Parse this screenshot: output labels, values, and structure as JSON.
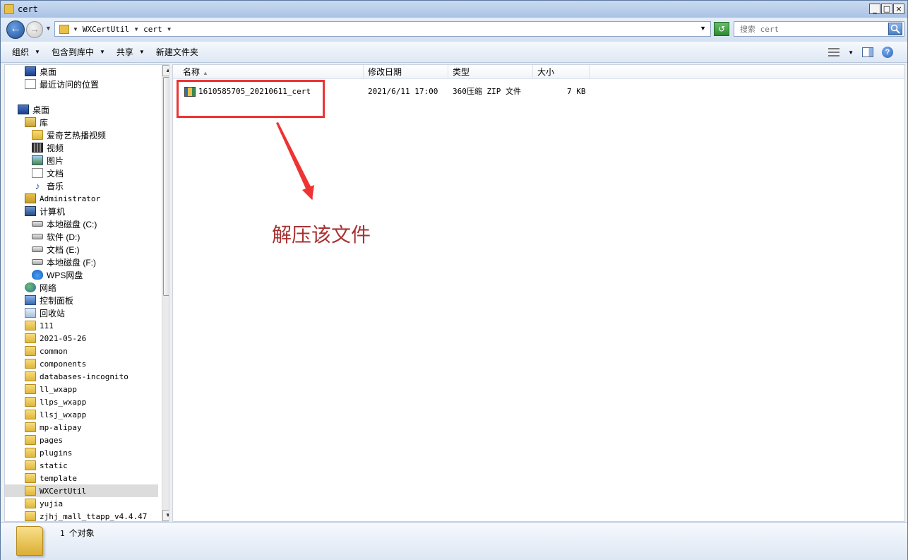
{
  "window": {
    "title": "cert",
    "minimize": "_",
    "maximize": "□",
    "close": "×"
  },
  "address": {
    "crumbs": [
      "WXCertUtil",
      "cert"
    ],
    "search_placeholder": "搜索 cert"
  },
  "toolbar": {
    "organize": "组织",
    "include_library": "包含到库中",
    "share": "共享",
    "new_folder": "新建文件夹"
  },
  "nav": {
    "favorites": [
      "桌面",
      "最近访问的位置"
    ],
    "desktop": "桌面",
    "library": "库",
    "library_items": [
      "爱奇艺热播视频",
      "视频",
      "图片",
      "文档",
      "音乐"
    ],
    "administrator": "Administrator",
    "computer": "计算机",
    "drives": [
      "本地磁盘 (C:)",
      "软件 (D:)",
      "文档 (E:)",
      "本地磁盘 (F:)",
      "WPS网盘"
    ],
    "network": "网络",
    "control_panel": "控制面板",
    "recycle_bin": "回收站",
    "folders": [
      "111",
      "2021-05-26",
      "common",
      "components",
      "databases-incognito",
      "ll_wxapp",
      "llps_wxapp",
      "llsj_wxapp",
      "mp-alipay",
      "pages",
      "plugins",
      "static",
      "template",
      "WXCertUtil",
      "yujia",
      "zjhj_mall_ttapp_v4.4.47"
    ]
  },
  "columns": {
    "name": "名称",
    "modified": "修改日期",
    "type": "类型",
    "size": "大小"
  },
  "files": [
    {
      "name": "1610585705_20210611_cert",
      "modified": "2021/6/11 17:00",
      "type": "360压缩 ZIP 文件",
      "size": "7 KB"
    }
  ],
  "annotation": "解压该文件",
  "status": {
    "count": "1",
    "label": "个对象"
  },
  "colors": {
    "highlight": "#ee3333",
    "annotation": "#a83232"
  }
}
